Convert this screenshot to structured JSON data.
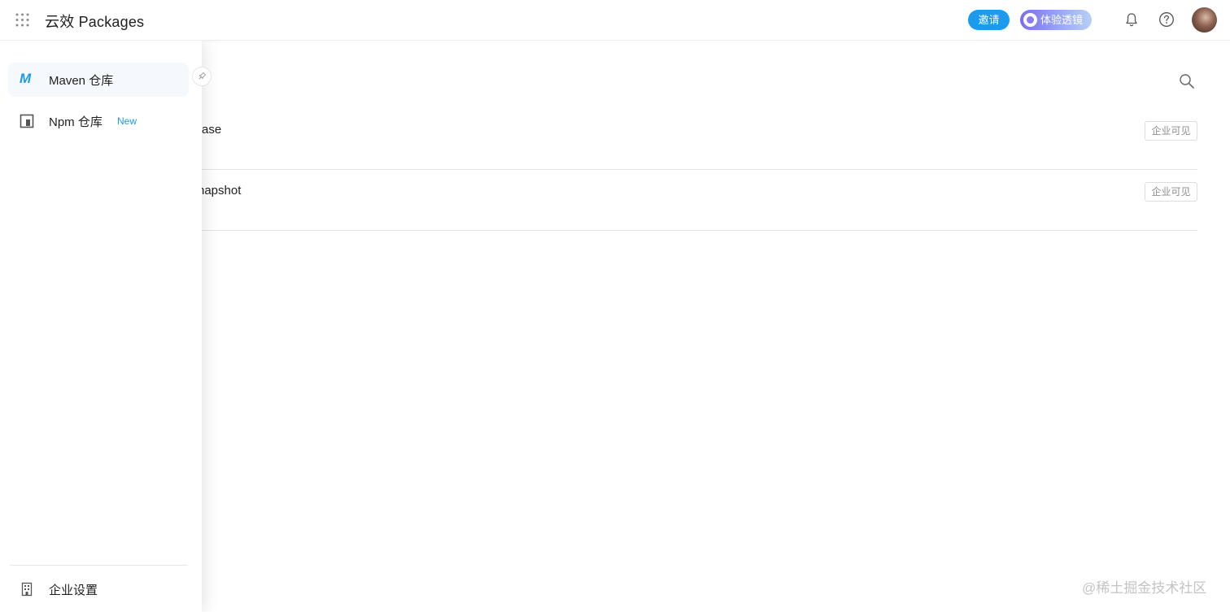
{
  "header": {
    "app_title": "云效 Packages",
    "invite_label": "邀请",
    "lens_label": "体验透镜",
    "colors": {
      "accent": "#1b9aee",
      "lens_start": "#7a6cf0",
      "lens_end": "#b7d0f7"
    },
    "icons": [
      "app-grid-icon",
      "bell-icon",
      "help-icon",
      "avatar"
    ]
  },
  "sidebar": {
    "items": [
      {
        "label": "Maven 仓库",
        "icon": "maven-icon",
        "active": true
      },
      {
        "label": "Npm 仓库",
        "icon": "npm-icon",
        "badge": "New",
        "active": false
      }
    ],
    "footer_item": {
      "label": "企业设置",
      "icon": "building-icon"
    },
    "pin_icon": "pin-icon"
  },
  "main": {
    "repos": [
      {
        "name_visible": "ase",
        "visibility": "企业可见"
      },
      {
        "name_visible": "napshot",
        "visibility": "企业可见"
      }
    ],
    "search_icon": "search-icon"
  },
  "watermark": "@稀土掘金技术社区"
}
